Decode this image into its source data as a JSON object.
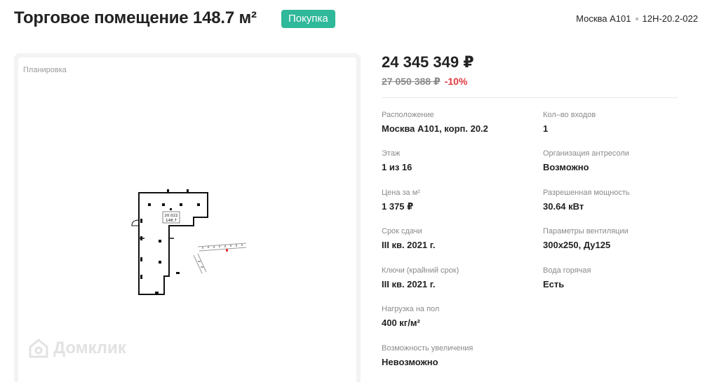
{
  "header": {
    "title": "Торговое помещение 148.7 м²",
    "badge": "Покупка",
    "location": "Москва А101",
    "code": "12Н-20.2-022"
  },
  "plan": {
    "label": "Планировка",
    "unit_tag": "20.022",
    "unit_area": "148.7",
    "watermark": "Домклик"
  },
  "price": {
    "current": "24 345 349 ₽",
    "old": "27 050 388 ₽",
    "discount": "-10%"
  },
  "details": {
    "left": [
      {
        "label": "Расположение",
        "value": "Москва А101, корп. 20.2"
      },
      {
        "label": "Этаж",
        "value": "1 из 16"
      },
      {
        "label": "Цена за м²",
        "value": "1 375 ₽"
      },
      {
        "label": "Срок сдачи",
        "value": "III кв. 2021 г."
      },
      {
        "label": "Ключи (крайний срок)",
        "value": "III кв. 2021 г."
      },
      {
        "label": "Нагрузка на пол",
        "value": "400 кг/м²"
      },
      {
        "label": "Возможность увеличения",
        "value": "Невозможно"
      }
    ],
    "right": [
      {
        "label": "Кол–во входов",
        "value": "1"
      },
      {
        "label": "Организация антресоли",
        "value": "Возможно"
      },
      {
        "label": "Разрешенная мощность",
        "value": "30.64 кВт"
      },
      {
        "label": "Параметры вентиляции",
        "value": "300х250, Ду125"
      },
      {
        "label": "Вода горячая",
        "value": "Есть"
      }
    ]
  },
  "colors": {
    "badge": "#2fb89a",
    "discount": "#e0383e"
  }
}
